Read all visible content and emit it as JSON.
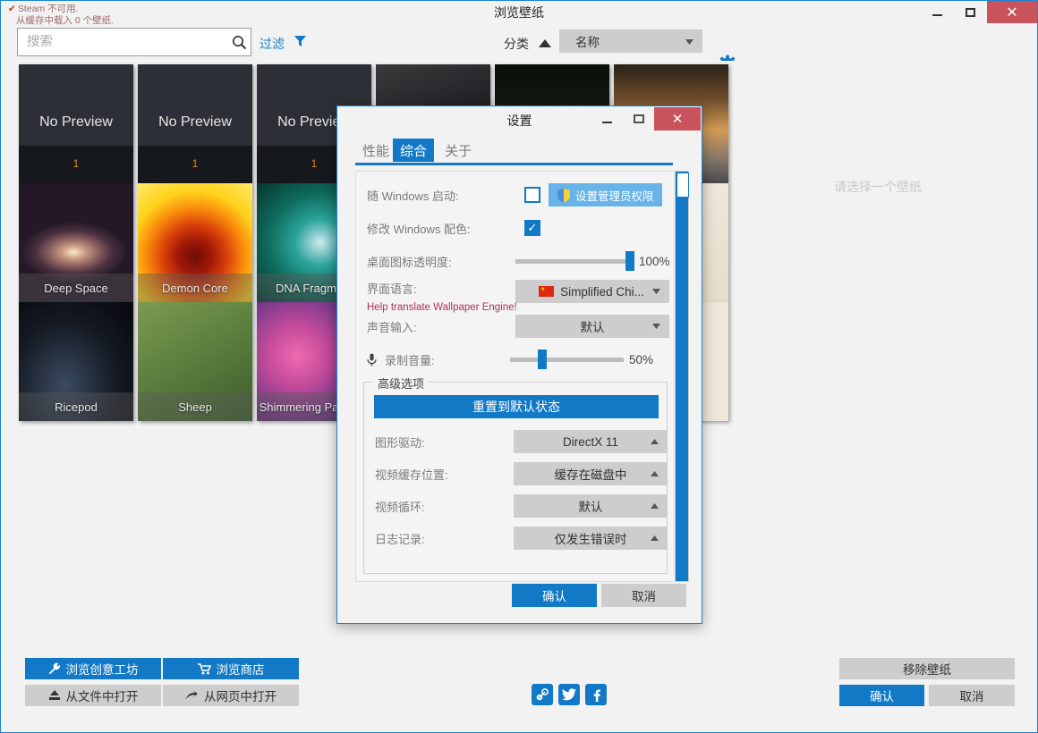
{
  "main_window": {
    "title": "浏览壁纸",
    "steam_status_line1": "Steam 不可用.",
    "steam_status_line2": "从缓存中载入 0 个壁纸.",
    "window_buttons": {
      "minimize": "–",
      "maximize": "□",
      "close": "✕"
    }
  },
  "toolbar": {
    "search_placeholder": "搜索",
    "search_value": "",
    "search_icon": "search-icon",
    "filter_label": "过滤",
    "filter_icon": "funnel-icon",
    "sort_label": "分类",
    "sort_direction_icon": "triangle-up-icon",
    "sort_value": "名称",
    "settings_icon": "gear-icon"
  },
  "gallery": {
    "empty_message": "请选择一个壁纸",
    "no_preview_label": "No Preview",
    "items": [
      {
        "label": "No Preview",
        "count": "1",
        "kind": "nopreview"
      },
      {
        "label": "No Preview",
        "count": "1",
        "kind": "nopreview"
      },
      {
        "label": "No Preview",
        "count": "1",
        "kind": "nopreview"
      },
      {
        "label": "",
        "count": "",
        "kind": "gun"
      },
      {
        "label": "",
        "count": "",
        "kind": "lamp"
      },
      {
        "label": "",
        "count": "",
        "kind": "palm"
      },
      {
        "label": "Deep Space",
        "count": "",
        "kind": "deepspace"
      },
      {
        "label": "Demon Core",
        "count": "",
        "kind": "demoncore"
      },
      {
        "label": "DNA Fragment",
        "count": "",
        "kind": "dna"
      },
      {
        "label": "",
        "count": "",
        "kind": "cream"
      },
      {
        "label": "Ricepod",
        "count": "",
        "kind": "ricepod"
      },
      {
        "label": "Sheep",
        "count": "",
        "kind": "sheep"
      },
      {
        "label": "Shimmering Particles",
        "count": "",
        "kind": "shimmer"
      },
      {
        "label": "",
        "count": "",
        "kind": "dots"
      }
    ]
  },
  "bottom_bar": {
    "browse_workshop": "浏览创意工坊",
    "browse_workshop_icon": "wrench-icon",
    "browse_store": "浏览商店",
    "browse_store_icon": "cart-icon",
    "open_from_file": "从文件中打开",
    "open_from_file_icon": "upload-icon",
    "open_from_web": "从网页中打开",
    "open_from_web_icon": "arrow-right-icon",
    "remove_wallpaper": "移除壁纸",
    "confirm": "确认",
    "cancel": "取消",
    "socials": [
      {
        "name": "steam-icon",
        "glyph": "◉"
      },
      {
        "name": "twitter-icon",
        "glyph": "🐦"
      },
      {
        "name": "facebook-icon",
        "glyph": "f"
      }
    ]
  },
  "settings_dialog": {
    "title": "设置",
    "window_buttons": {
      "minimize": "–",
      "maximize": "□",
      "close": "✕"
    },
    "tabs": [
      {
        "label": "性能",
        "active": false
      },
      {
        "label": "综合",
        "active": true
      },
      {
        "label": "关于",
        "active": false
      }
    ],
    "general": {
      "start_with_windows_label": "随 Windows 启动:",
      "start_with_windows_checked": "false",
      "admin_button": "设置管理员权限",
      "admin_button_icon": "shield-icon",
      "modify_windows_color_label": "修改 Windows 配色:",
      "modify_windows_color_checked": "true",
      "desktop_icon_opacity_label": "桌面图标透明度:",
      "desktop_icon_opacity_value": "100%",
      "desktop_icon_opacity_percent": 100,
      "ui_language_label": "界面语言:",
      "ui_language_value": "Simplified Chi...",
      "ui_language_flag": "china-flag-icon",
      "help_translate_link": "Help translate Wallpaper Engine!",
      "audio_input_label": "声音输入:",
      "audio_input_value": "默认",
      "recording_volume_label": "录制音量:",
      "recording_volume_icon": "microphone-icon",
      "recording_volume_value": "50%",
      "recording_volume_percent": 50
    },
    "advanced": {
      "group_title": "高级选项",
      "reset_button": "重置到默认状态",
      "graphics_driver_label": "图形驱动:",
      "graphics_driver_value": "DirectX 11",
      "video_cache_label": "视频缓存位置:",
      "video_cache_value": "缓存在磁盘中",
      "video_loop_label": "视频循环:",
      "video_loop_value": "默认",
      "logging_label": "日志记录:",
      "logging_value": "仅发生错误时"
    },
    "footer": {
      "confirm": "确认",
      "cancel": "取消"
    }
  },
  "colors": {
    "accent": "#1279c6",
    "close_red": "#c9535a",
    "link_red": "#b0305a",
    "grey_button": "#cdcdcd"
  }
}
